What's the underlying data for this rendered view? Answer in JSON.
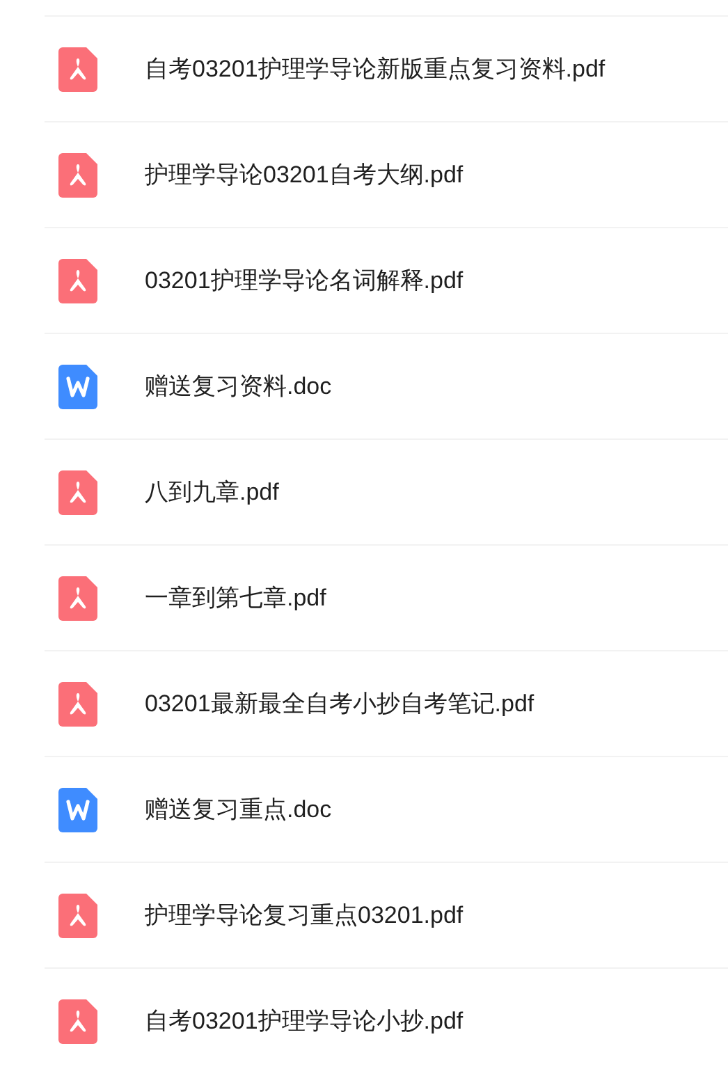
{
  "files": [
    {
      "name": "自考03201护理学导论新版重点复习资料.pdf",
      "kind": "pdf"
    },
    {
      "name": "护理学导论03201自考大纲.pdf",
      "kind": "pdf"
    },
    {
      "name": "03201护理学导论名词解释.pdf",
      "kind": "pdf"
    },
    {
      "name": "赠送复习资料.doc",
      "kind": "doc"
    },
    {
      "name": "八到九章.pdf",
      "kind": "pdf"
    },
    {
      "name": "一章到第七章.pdf",
      "kind": "pdf"
    },
    {
      "name": "03201最新最全自考小抄自考笔记.pdf",
      "kind": "pdf"
    },
    {
      "name": "赠送复习重点.doc",
      "kind": "doc"
    },
    {
      "name": "护理学导论复习重点03201.pdf",
      "kind": "pdf"
    },
    {
      "name": "自考03201护理学导论小抄.pdf",
      "kind": "pdf"
    }
  ]
}
